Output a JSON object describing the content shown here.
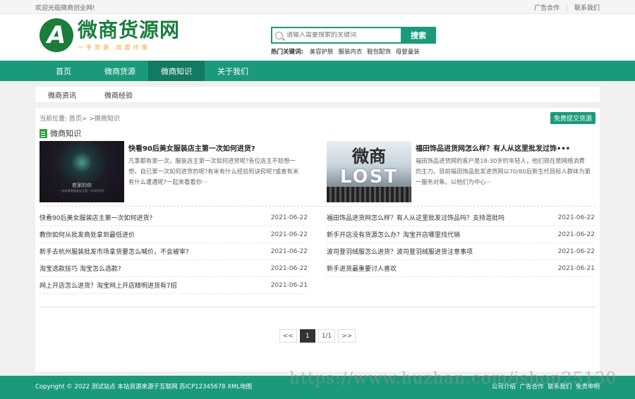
{
  "topbar": {
    "welcome": "欢迎光临微商创业网!",
    "links": [
      "广告合作",
      "联系我们"
    ],
    "sep": "|"
  },
  "header": {
    "logo_letter": "A",
    "logo_title": "微商货源网",
    "logo_slogan": "一手货源 加盟代理",
    "search_placeholder": "请输入需要搜索的关键词",
    "search_button": "搜索",
    "hot_label": "热门关键词:",
    "hot_keywords": [
      "美容护肤",
      "服装内衣",
      "鞋包配饰",
      "母婴童装"
    ]
  },
  "nav": {
    "items": [
      "首页",
      "微商货源",
      "微商知识",
      "关于我们"
    ],
    "active_index": 2
  },
  "subnav": {
    "items": [
      "微商资讯",
      "微商经验"
    ]
  },
  "main": {
    "breadcrumb": "当前位置: 首页> >微商知识",
    "submit_button": "免费提交货源",
    "section_title": "微商知识",
    "features": [
      {
        "title": "快看90后美女服装店主第一次如何进货?",
        "desc": "凡事都有第一次，服装店主第一次如何进货呢?各位店主不妨想一想，自已第一次如何进货的呢?有米有什么经验和诀窍呢?或者有米有什么遭遇呢?一起来看看你···",
        "thumb_line1": "若家的你",
        "thumb_line2": "一起来看看服装店主第一次如何进货"
      },
      {
        "title": "福田饰品进货网怎么样？有人从这里批发过饰•••",
        "desc": "福田饰品进货网的客户是18-30岁的年轻人，他们现在是网络消费的主力。目前福田饰品批发进货网以70/80后新生代目标人群体为第一服务对象。以他们为中心···",
        "thumb_word": "微商",
        "thumb_lost": "LOST"
      }
    ],
    "list_left": [
      {
        "title": "快看90后美女服装店主第一次如何进货?",
        "date": "2021-06-22"
      },
      {
        "title": "教你如何从批发商处拿到最低进价",
        "date": "2021-06-22"
      },
      {
        "title": "新手去杭州服装批发市场拿货要怎么喊价，不会被宰?",
        "date": "2021-06-22"
      },
      {
        "title": "淘宝选款技巧 淘宝怎么选款?",
        "date": "2021-06-22"
      },
      {
        "title": "网上开店怎么进货？淘宝网上开店精明进货有7招",
        "date": "2021-06-21"
      }
    ],
    "list_right": [
      {
        "title": "福田饰品进货网怎么样？有人从这里批发过饰品吗？支持混批吗",
        "date": "2021-06-22"
      },
      {
        "title": "新手开店没有货源怎么办？淘宝开店哪里找代销",
        "date": "2021-06-22"
      },
      {
        "title": "波司登羽绒服怎么进货？波司登羽绒服进货注意事项",
        "date": "2021-06-22"
      },
      {
        "title": "新手进货最重要讨人喜欢",
        "date": "2021-06-21"
      }
    ],
    "pager": {
      "prev": "<<",
      "current": "1",
      "total": "1/1",
      "next": ">>"
    }
  },
  "footer": {
    "copyright": "Copyright © 2022 测试站点 本站资源来源于互联网 苏ICP12345678 XML地图",
    "links": [
      "公司介绍",
      "广告合作",
      "联系我们",
      "免责申明"
    ]
  },
  "watermark": "https://www.huzhan.com/ishop25130",
  "colors": {
    "primary": "#1a9a7b",
    "nav_active": "#137a62",
    "logo_green": "#1a7d3c",
    "slogan_orange": "#f0a020"
  }
}
